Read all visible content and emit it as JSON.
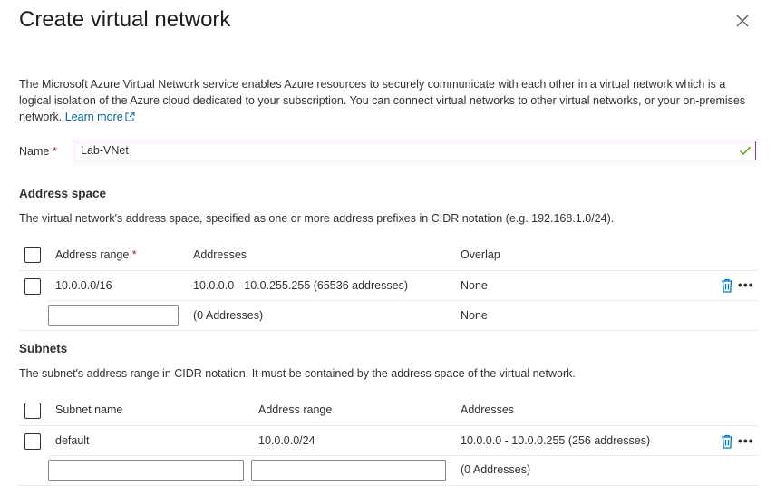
{
  "panel": {
    "title": "Create virtual network",
    "description": "The Microsoft Azure Virtual Network service enables Azure resources to securely communicate with each other in a virtual network which is a logical isolation of the Azure cloud dedicated to your subscription. You can connect virtual networks to other virtual networks, or your on-premises network.",
    "learn_more": "Learn more"
  },
  "name_field": {
    "label": "Name",
    "required_mark": "*",
    "value": "Lab-VNet"
  },
  "address_space": {
    "title": "Address space",
    "description": "The virtual network's address space, specified as one or more address prefixes in CIDR notation (e.g. 192.168.1.0/24).",
    "headers": {
      "range": "Address range",
      "required_mark": "*",
      "addresses": "Addresses",
      "overlap": "Overlap"
    },
    "rows": [
      {
        "range": "10.0.0.0/16",
        "addresses": "10.0.0.0 - 10.0.255.255 (65536 addresses)",
        "overlap": "None"
      }
    ],
    "new_row": {
      "range_value": "",
      "addresses": "(0 Addresses)",
      "overlap": "None"
    }
  },
  "subnets": {
    "title": "Subnets",
    "description": "The subnet's address range in CIDR notation. It must be contained by the address space of the virtual network.",
    "headers": {
      "name": "Subnet name",
      "range": "Address range",
      "addresses": "Addresses"
    },
    "rows": [
      {
        "name": "default",
        "range": "10.0.0.0/24",
        "addresses": "10.0.0.0 - 10.0.0.255 (256 addresses)"
      }
    ],
    "new_row": {
      "name_value": "",
      "range_value": "",
      "addresses": "(0 Addresses)"
    }
  },
  "more_glyph": "•••",
  "colors": {
    "link": "#0063b1",
    "trash": "#0078d4",
    "check": "#57a300",
    "focus_border": "#8a3f93",
    "required": "#a4262c"
  }
}
